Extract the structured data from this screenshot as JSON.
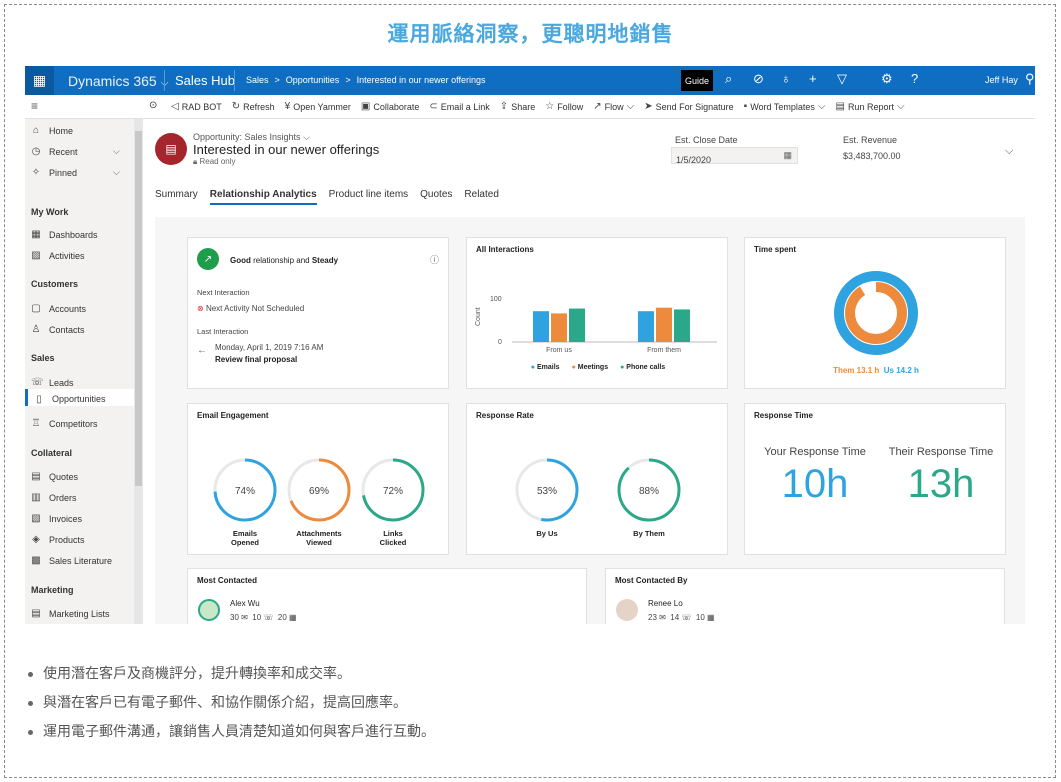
{
  "heading": "運用脈絡洞察，更聰明地銷售",
  "topbar": {
    "app": "Dynamics 365",
    "hub": "Sales Hub",
    "breadcrumb": [
      "Sales",
      ">",
      "Opportunities",
      ">",
      "Interested in our newer offerings"
    ],
    "guide": "Guide",
    "user": "Jeff Hay",
    "accent": "#0f6ec2"
  },
  "commands": [
    "RAD BOT",
    "Refresh",
    "Open Yammer",
    "Collaborate",
    "Email a Link",
    "Share",
    "Follow",
    "Flow",
    "Send For Signature",
    "Word Templates",
    "Run Report"
  ],
  "sidebar": {
    "top": [
      "Home",
      "Recent",
      "Pinned"
    ],
    "groups": [
      {
        "name": "My Work",
        "items": [
          "Dashboards",
          "Activities"
        ]
      },
      {
        "name": "Customers",
        "items": [
          "Accounts",
          "Contacts"
        ]
      },
      {
        "name": "Sales",
        "items": [
          "Leads",
          "Opportunities",
          "Competitors"
        ]
      },
      {
        "name": "Collateral",
        "items": [
          "Quotes",
          "Orders",
          "Invoices",
          "Products",
          "Sales Literature"
        ]
      },
      {
        "name": "Marketing",
        "items": [
          "Marketing Lists"
        ]
      }
    ]
  },
  "record": {
    "subtitle": "Opportunity: Sales Insights",
    "title": "Interested in our newer offerings",
    "readonly": "Read only",
    "close_label": "Est. Close Date",
    "close_value": "1/5/2020",
    "revenue_label": "Est. Revenue",
    "revenue_value": "$3,483,700.00"
  },
  "tabs": [
    "Summary",
    "Relationship Analytics",
    "Product line items",
    "Quotes",
    "Related"
  ],
  "relationship": {
    "status_good": "Good",
    "status_mid": " relationship and ",
    "status_steady": "Steady",
    "next_label": "Next Interaction",
    "next_value": "Next Activity Not Scheduled",
    "last_label": "Last Interaction",
    "last_date": "Monday, April 1, 2019 7:16 AM",
    "last_value": "Review final proposal"
  },
  "interactions": {
    "title": "All Interactions",
    "ylabel": "Count",
    "ticks": [
      "100",
      "0"
    ],
    "legend": [
      "Emails",
      "Meetings",
      "Phone calls"
    ]
  },
  "time_spent": {
    "title": "Time spent",
    "them": "Them 13.1 h",
    "us": "Us 14.2 h"
  },
  "email_engagement": {
    "title": "Email Engagement",
    "items": [
      {
        "pct": "74%",
        "label1": "Emails",
        "label2": "Opened",
        "value": 0.74,
        "color": "#2ea3df"
      },
      {
        "pct": "69%",
        "label1": "Attachments",
        "label2": "Viewed",
        "value": 0.69,
        "color": "#ee8a3c"
      },
      {
        "pct": "72%",
        "label1": "Links",
        "label2": "Clicked",
        "value": 0.72,
        "color": "#2aa889"
      }
    ]
  },
  "response_rate": {
    "title": "Response Rate",
    "items": [
      {
        "pct": "53%",
        "label": "By Us",
        "value": 0.53,
        "color": "#2ea3df"
      },
      {
        "pct": "88%",
        "label": "By Them",
        "value": 0.88,
        "color": "#2aa889"
      }
    ]
  },
  "response_time": {
    "title": "Response Time",
    "your_label": "Your Response Time",
    "your_value": "10h",
    "their_label": "Their Response Time",
    "their_value": "13h"
  },
  "most_contacted": {
    "title": "Most Contacted",
    "name": "Alex Wu",
    "emails": "30",
    "calls": "10",
    "meetings": "20"
  },
  "most_contacted_by": {
    "title": "Most Contacted By",
    "name": "Renee Lo",
    "emails": "23",
    "calls": "14",
    "meetings": "10"
  },
  "chart_data": {
    "type": "bar",
    "categories": [
      "From us",
      "From them"
    ],
    "series": [
      {
        "name": "Emails",
        "values": [
          70,
          70
        ],
        "color": "#2ea3df"
      },
      {
        "name": "Meetings",
        "values": [
          65,
          78
        ],
        "color": "#ee8a3c"
      },
      {
        "name": "Phone calls",
        "values": [
          76,
          74
        ],
        "color": "#2aa889"
      }
    ],
    "title": "All Interactions",
    "ylabel": "Count",
    "ylim": [
      0,
      100
    ]
  },
  "time_split": {
    "them": 13.1,
    "us": 14.2,
    "them_color": "#ee8a3c",
    "us_color": "#2ea3df"
  },
  "bullets": [
    "使用潛在客戶及商機評分，提升轉換率和成交率。",
    "與潛在客戶已有電子郵件、和協作關係介紹，提高回應率。",
    "運用電子郵件溝通，讓銷售人員清楚知道如何與客戶進行互動。"
  ]
}
